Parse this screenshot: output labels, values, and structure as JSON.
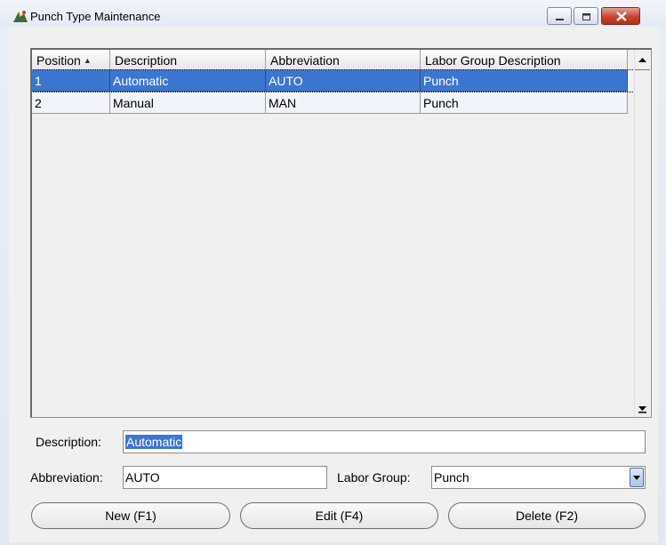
{
  "window": {
    "title": "Punch Type Maintenance",
    "icon": "app-logo-icon",
    "controls": [
      "minimize-icon",
      "maximize-icon",
      "close-icon"
    ]
  },
  "grid": {
    "columns": [
      "Position",
      "Description",
      "Abbreviation",
      "Labor Group Description"
    ],
    "sort_indicator": "▲",
    "rows": [
      {
        "position": "1",
        "description": "Automatic",
        "abbreviation": "AUTO",
        "labor_group": "Punch",
        "selected": true
      },
      {
        "position": "2",
        "description": "Manual",
        "abbreviation": "MAN",
        "labor_group": "Punch",
        "selected": false
      }
    ]
  },
  "form": {
    "description_label": "Description:",
    "description_value": "Automatic",
    "abbreviation_label": "Abbreviation:",
    "abbreviation_value": "AUTO",
    "labor_group_label": "Labor Group:",
    "labor_group_value": "Punch"
  },
  "buttons": {
    "new": "New (F1)",
    "edit": "Edit (F4)",
    "delete": "Delete (F2)"
  },
  "colors": {
    "selection": "#3b76cf",
    "close_button": "#c6432c"
  }
}
